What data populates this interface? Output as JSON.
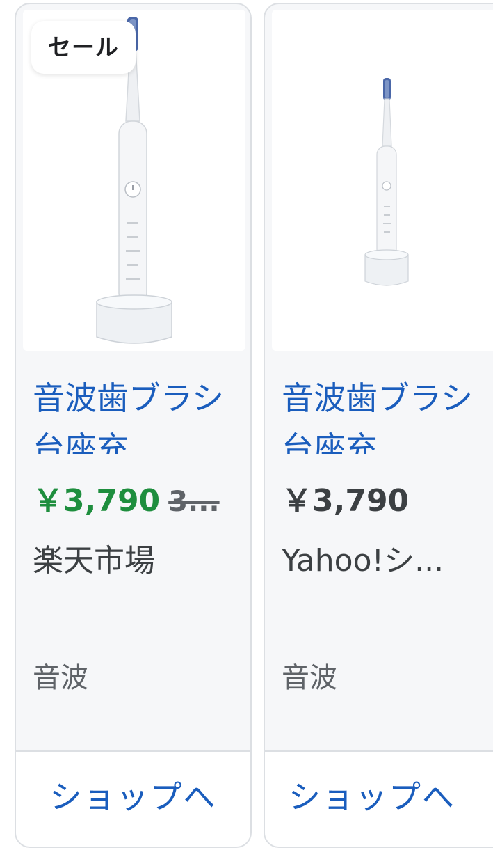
{
  "cards": [
    {
      "badge": "セール",
      "title": "音波歯ブラシ 台座充",
      "price": "￥3,790",
      "old_price": "3...",
      "store": "楽天市場",
      "tag": "音波",
      "button": "ショップへ"
    },
    {
      "title": "音波歯ブラシ 台座充",
      "price": "￥3,790",
      "store": "Yahoo!シ...",
      "tag": "音波",
      "button": "ショップへ"
    }
  ],
  "colors": {
    "link": "#1a5dbd",
    "sale_price": "#1e8e3e",
    "price": "#3c4043"
  }
}
